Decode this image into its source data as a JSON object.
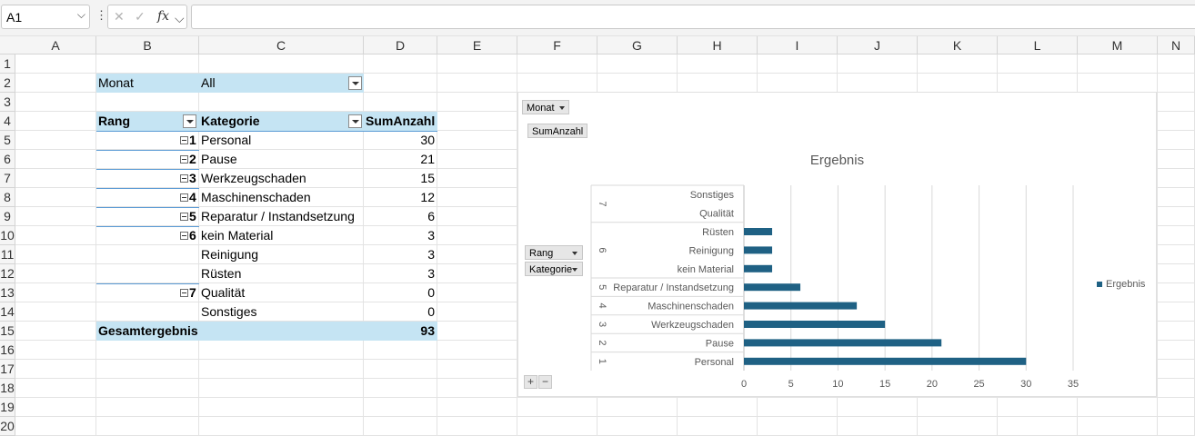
{
  "formula_bar": {
    "name_box": "A1",
    "fx_label": "fx",
    "formula": ""
  },
  "columns": [
    "A",
    "B",
    "C",
    "D",
    "E",
    "F",
    "G",
    "H",
    "I",
    "J",
    "K",
    "L",
    "M",
    "N"
  ],
  "rows": [
    "1",
    "2",
    "3",
    "4",
    "5",
    "6",
    "7",
    "8",
    "9",
    "10",
    "11",
    "12",
    "13",
    "14",
    "15",
    "16",
    "17",
    "18",
    "19",
    "20"
  ],
  "pivot": {
    "filter_label": "Monat",
    "filter_value": "All",
    "headers": {
      "rang": "Rang",
      "kategorie": "Kategorie",
      "sum": "SumAnzahl"
    },
    "rows": [
      {
        "rank": "1",
        "category": "Personal",
        "value": "30"
      },
      {
        "rank": "2",
        "category": "Pause",
        "value": "21"
      },
      {
        "rank": "3",
        "category": "Werkzeugschaden",
        "value": "15"
      },
      {
        "rank": "4",
        "category": "Maschinenschaden",
        "value": "12"
      },
      {
        "rank": "5",
        "category": "Reparatur / Instandsetzung",
        "value": "6"
      },
      {
        "rank": "6",
        "category": "kein Material",
        "value": "3"
      },
      {
        "rank": "",
        "category": "Reinigung",
        "value": "3"
      },
      {
        "rank": "",
        "category": "Rüsten",
        "value": "3"
      },
      {
        "rank": "7",
        "category": "Qualität",
        "value": "0"
      },
      {
        "rank": "",
        "category": "Sonstiges",
        "value": "0"
      }
    ],
    "total_label": "Gesamtergebnis",
    "total_value": "93"
  },
  "chart_buttons": {
    "filter": "Monat",
    "values": "SumAnzahl",
    "axis1": "Rang",
    "axis2": "Kategorie",
    "expand": "+",
    "collapse": "−"
  },
  "chart_data": {
    "type": "bar",
    "title": "Ergebnis",
    "orientation": "horizontal",
    "categories": [
      {
        "rank": "1",
        "label": "Personal",
        "value": 30
      },
      {
        "rank": "2",
        "label": "Pause",
        "value": 21
      },
      {
        "rank": "3",
        "label": "Werkzeugschaden",
        "value": 15
      },
      {
        "rank": "4",
        "label": "Maschinenschaden",
        "value": 12
      },
      {
        "rank": "5",
        "label": "Reparatur / Instandsetzung",
        "value": 6
      },
      {
        "rank": "6",
        "label": "kein Material",
        "value": 3
      },
      {
        "rank": "6",
        "label": "Reinigung",
        "value": 3
      },
      {
        "rank": "6",
        "label": "Rüsten",
        "value": 3
      },
      {
        "rank": "7",
        "label": "Qualität",
        "value": 0
      },
      {
        "rank": "7",
        "label": "Sonstiges",
        "value": 0
      }
    ],
    "rank_groups": [
      "1",
      "2",
      "3",
      "4",
      "5",
      "6",
      "7"
    ],
    "series": [
      {
        "name": "Ergebnis",
        "values": [
          30,
          21,
          15,
          12,
          6,
          3,
          3,
          3,
          0,
          0
        ]
      }
    ],
    "xlim": [
      0,
      35
    ],
    "xticks": [
      "0",
      "5",
      "10",
      "15",
      "20",
      "25",
      "30",
      "35"
    ],
    "grid": true,
    "legend_position": "right",
    "bar_color": "#1f6184"
  }
}
